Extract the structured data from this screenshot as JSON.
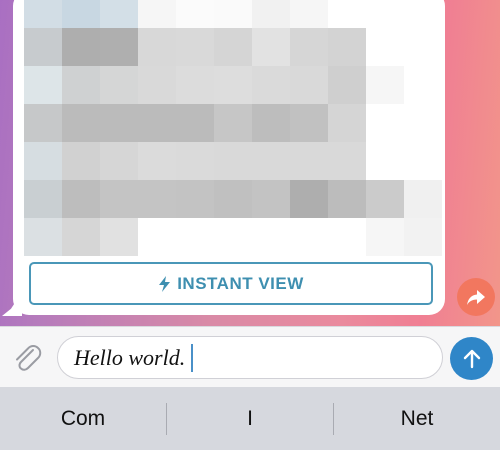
{
  "message": {
    "instant_view_label": "INSTANT VIEW"
  },
  "composer": {
    "text": "Hello world."
  },
  "keyboard": {
    "suggestions": [
      "Com",
      "I",
      "Net"
    ]
  },
  "colors": {
    "accent": "#3e8fb0",
    "send_button": "#2f86c8",
    "share_button": "#f2775f"
  },
  "icons": {
    "instant_view": "lightning-bolt-icon",
    "share": "share-arrow-icon",
    "attach": "paperclip-icon",
    "send": "arrow-up-icon"
  }
}
